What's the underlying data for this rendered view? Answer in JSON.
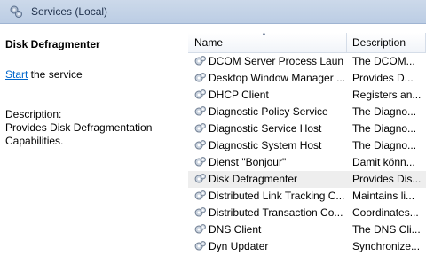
{
  "window": {
    "title": "Services (Local)"
  },
  "detail": {
    "service_name": "Disk Defragmenter",
    "start_link": "Start",
    "start_suffix": " the service",
    "description_label": "Description:",
    "description_text": "Provides Disk Defragmentation Capabilities."
  },
  "columns": {
    "name": "Name",
    "description": "Description"
  },
  "services": [
    {
      "name": "DCOM Server Process Laun...",
      "description": "The DCOM..."
    },
    {
      "name": "Desktop Window Manager ...",
      "description": "Provides D..."
    },
    {
      "name": "DHCP Client",
      "description": "Registers an..."
    },
    {
      "name": "Diagnostic Policy Service",
      "description": "The Diagno..."
    },
    {
      "name": "Diagnostic Service Host",
      "description": "The Diagno..."
    },
    {
      "name": "Diagnostic System Host",
      "description": "The Diagno..."
    },
    {
      "name": "Dienst \"Bonjour\"",
      "description": "Damit könn..."
    },
    {
      "name": "Disk Defragmenter",
      "description": "Provides Dis...",
      "selected": true
    },
    {
      "name": "Distributed Link Tracking C...",
      "description": "Maintains li..."
    },
    {
      "name": "Distributed Transaction Co...",
      "description": "Coordinates..."
    },
    {
      "name": "DNS Client",
      "description": "The DNS Cli..."
    },
    {
      "name": "Dyn Updater",
      "description": "Synchronize..."
    }
  ],
  "icons": {
    "window": "services-gear-icon",
    "service": "service-gear-icon"
  }
}
